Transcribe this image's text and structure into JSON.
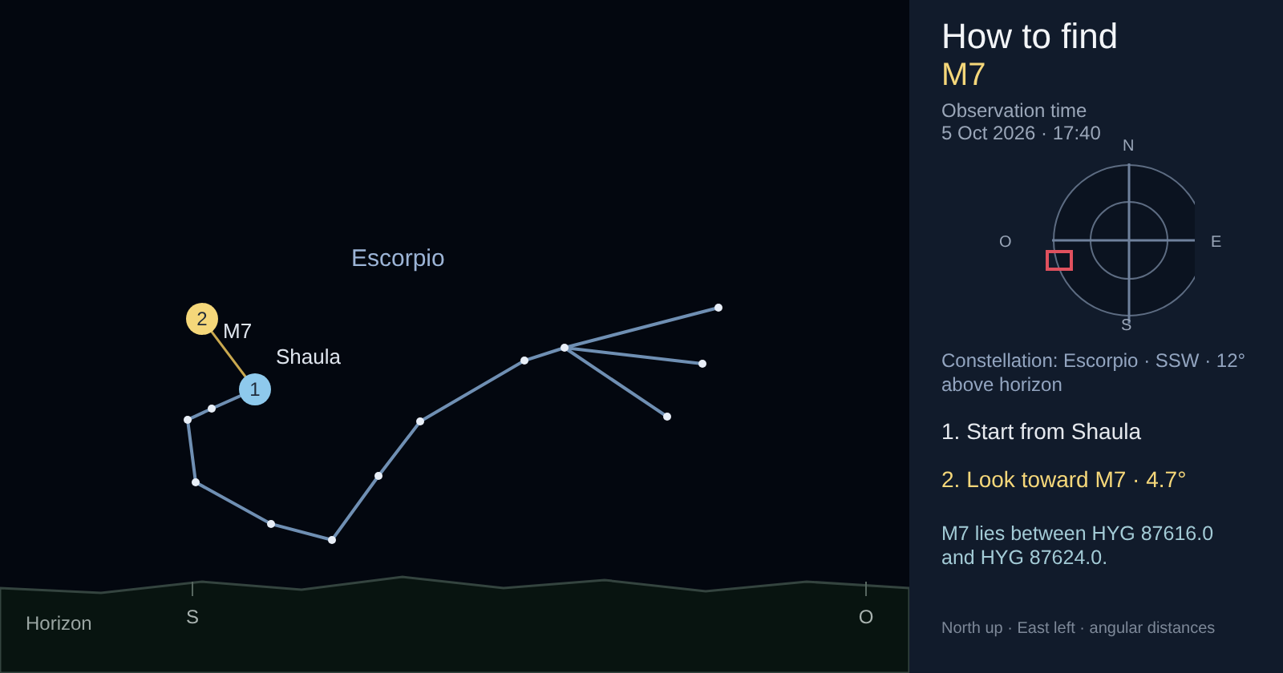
{
  "sky": {
    "constellation_label": "Escorpio",
    "markers": [
      {
        "number": "2",
        "label": "M7",
        "color": "#f5d77a"
      },
      {
        "number": "1",
        "label": "Shaula",
        "color": "#8ec9ec"
      }
    ],
    "horizon_label": "Horizon",
    "directions": [
      "S",
      "O"
    ]
  },
  "panel": {
    "title": "How to find",
    "target": "M7",
    "observation_label": "Observation time",
    "observation_time": "5 Oct 2026 · 17:40",
    "compass": {
      "north": "N",
      "west": "O",
      "east": "E",
      "south": "S"
    },
    "constellation_info": "Constellation: Escorpio · SSW · 12° above horizon",
    "steps": [
      {
        "text": "1. Start from Shaula",
        "color": "#e6e9ee"
      },
      {
        "text": "2. Look toward M7 · 4.7°",
        "color": "#f5d77a"
      }
    ],
    "note": "M7 lies between HYG 87616.0 and HYG 87624.0.",
    "footer": "North up · East left · angular distances"
  }
}
